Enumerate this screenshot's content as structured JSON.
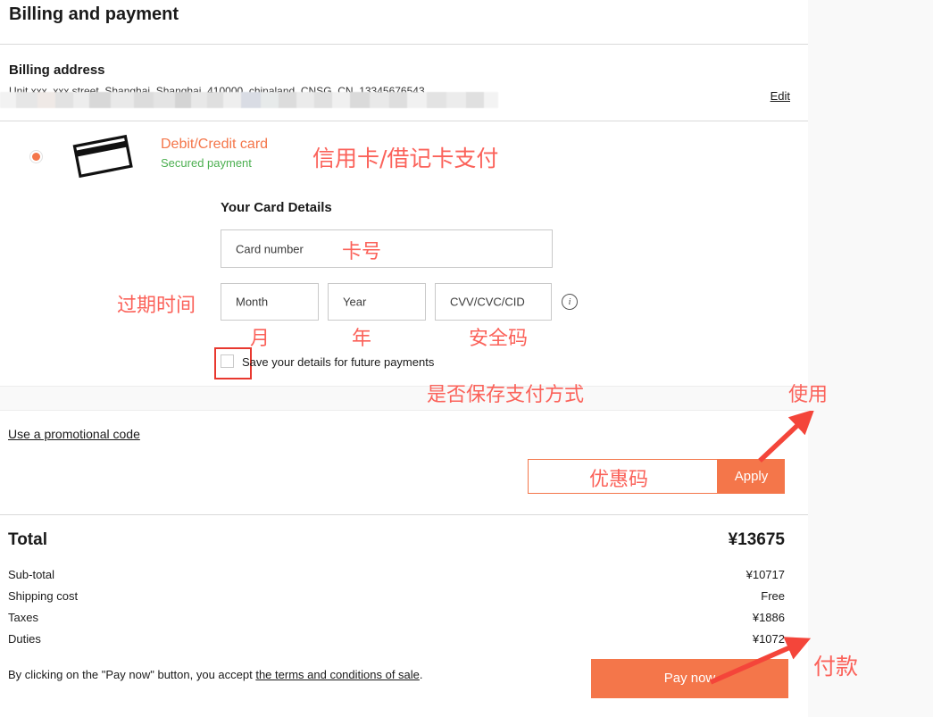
{
  "page": {
    "title": "Billing and payment"
  },
  "billing_address": {
    "section_title": "Billing address",
    "address_text": "Unit xxx, xxx street, Shanghai, Shanghai, 410000, chinaland, CNSG, CN, 13345676543",
    "edit_label": "Edit",
    "redacted": true
  },
  "payment_method": {
    "selected": true,
    "icon": "credit-card-icon",
    "title": "Debit/Credit card",
    "subtitle": "Secured payment"
  },
  "card_details": {
    "heading": "Your Card Details",
    "card_number_placeholder": "Card number",
    "card_number_value": "",
    "month_placeholder": "Month",
    "month_value": "",
    "year_placeholder": "Year",
    "year_value": "",
    "cvv_placeholder": "CVV/CVC/CID",
    "cvv_value": "",
    "info_icon": "info-icon",
    "info_glyph": "i",
    "save_details_label": "Save your details for future payments",
    "save_details_checked": false
  },
  "promo": {
    "link_label": "Use a promotional code",
    "input_value": "",
    "input_placeholder": "",
    "apply_label": "Apply"
  },
  "totals": {
    "total_label": "Total",
    "total_value": "¥13675",
    "lines": [
      {
        "label": "Sub-total",
        "value": "¥10717"
      },
      {
        "label": "Shipping cost",
        "value": "Free"
      },
      {
        "label": "Taxes",
        "value": "¥1886"
      },
      {
        "label": "Duties",
        "value": "¥1072"
      }
    ]
  },
  "footer": {
    "terms_prefix": "By clicking on the \"Pay now\" button, you accept ",
    "terms_link": "the terms and conditions of sale",
    "terms_suffix": ".",
    "pay_label": "Pay now"
  },
  "annotations": {
    "method": "信用卡/借记卡支付",
    "card_number": "卡号",
    "expiry": "过期时间",
    "month": "月",
    "year": "年",
    "cvv": "安全码",
    "save_details": "是否保存支付方式",
    "apply": "使用",
    "promo_code": "优惠码",
    "pay": "付款"
  },
  "colors": {
    "accent": "#f4764a",
    "annotation_red": "#fb625a",
    "highlight_box": "#e8382f",
    "secure_green": "#4caf50",
    "gutter": "#f9f9f9"
  }
}
